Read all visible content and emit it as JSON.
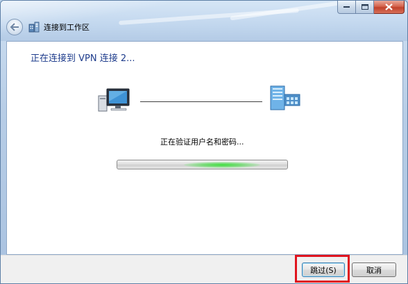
{
  "window": {
    "title": "连接到工作区",
    "caption_buttons": [
      "minimize",
      "maximize",
      "close"
    ]
  },
  "main": {
    "heading": "正在连接到 VPN 连接 2...",
    "status": "正在验证用户名和密码...",
    "progress": {
      "state": "indeterminate"
    },
    "icons": {
      "local": "computer-icon",
      "remote": "server-icon"
    }
  },
  "footer": {
    "skip_label": "跳过(S)",
    "cancel_label": "取消"
  },
  "colors": {
    "heading": "#1e3c8c",
    "progress_glow": "#3fe03f",
    "highlight": "#e0141e"
  }
}
